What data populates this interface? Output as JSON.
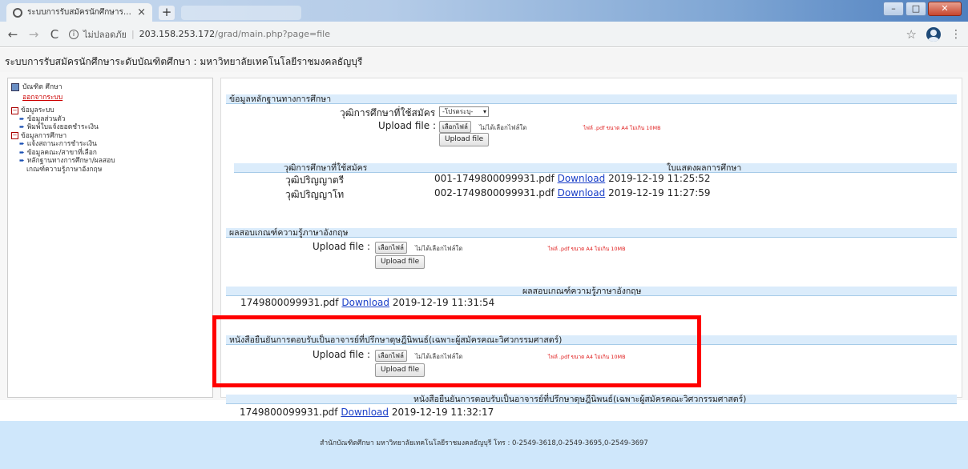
{
  "browser": {
    "tab_title": "ระบบการรับสมัครนักศึกษาระดับปริญญ",
    "tab_close": "×",
    "newtab": "+",
    "url_security": "ไม่ปลอดภัย",
    "url_host": "203.158.253.172",
    "url_path": "/grad/main.php?page=file",
    "window_controls": {
      "minimize": "–",
      "maximize": "□",
      "close": "✕"
    }
  },
  "page_header": "ระบบการรับสมัครนักศึกษาระดับบัณฑิตศึกษา : มหาวิทยาลัยเทคโนโลยีราชมงคลธัญบุรี",
  "sidebar": {
    "user": "บัณฑิต ศึกษา",
    "logout": "ออกจากระบบ",
    "groups": [
      {
        "title": "ข้อมูลระบบ",
        "items": [
          "ข้อมูลส่วนตัว",
          "พิมพ์ใบแจ้งยอดชำระเงิน"
        ]
      },
      {
        "title": "ข้อมูลการศึกษา",
        "items": [
          "แจ้งสถานะการชำระเงิน",
          "ข้อมูลคณะ/สาขาที่เลือก",
          "หลักฐานทางการศึกษา/ผลสอบ",
          "เกณฑ์ความรู้ภาษาอังกฤษ"
        ]
      }
    ]
  },
  "section1": {
    "title": "ข้อมูลหลักฐานทางการศึกษา",
    "degree_label": "วุฒิการศึกษาที่ใช้สมัคร :",
    "degree_select": "-โปรดระบุ-",
    "upload_label": "Upload file :",
    "choose_button": "เลือกไฟล์",
    "no_file": "ไม่ได้เลือกไฟล์ใด",
    "note": "ไฟล์ .pdf ขนาด A4 ไม่เกิน 10MB",
    "upload_button": "Upload file",
    "table_headers": [
      "วุฒิการศึกษาที่ใช้สมัคร",
      "ใบแสดงผลการศึกษา"
    ],
    "rows": [
      {
        "degree": "วุฒิปริญญาตรี",
        "file": "001-1749800099931.pdf",
        "link": "Download",
        "date": "2019-12-19 11:25:52"
      },
      {
        "degree": "วุฒิปริญญาโท",
        "file": "002-1749800099931.pdf",
        "link": "Download",
        "date": "2019-12-19 11:27:59"
      }
    ]
  },
  "section2": {
    "title": "ผลสอบเกณฑ์ความรู้ภาษาอังกฤษ",
    "upload_label": "Upload file :",
    "choose_button": "เลือกไฟล์",
    "no_file": "ไม่ได้เลือกไฟล์ใด",
    "note": "ไฟล์ .pdf ขนาด A4 ไม่เกิน 10MB",
    "upload_button": "Upload file",
    "table_header": "ผลสอบเกณฑ์ความรู้ภาษาอังกฤษ",
    "row": {
      "file": "1749800099931.pdf",
      "link": "Download",
      "date": "2019-12-19 11:31:54"
    }
  },
  "section3": {
    "title": "หนังสือยืนยันการตอบรับเป็นอาจารย์ที่ปรึกษาดุษฎีนิพนธ์(เฉพาะผู้สมัครคณะวิศวกรรมศาสตร์)",
    "upload_label": "Upload file :",
    "choose_button": "เลือกไฟล์",
    "no_file": "ไม่ได้เลือกไฟล์ใด",
    "note": "ไฟล์ .pdf ขนาด A4 ไม่เกิน 10MB",
    "upload_button": "Upload file",
    "table_header": "หนังสือยืนยันการตอบรับเป็นอาจารย์ที่ปรึกษาดุษฎีนิพนธ์(เฉพาะผู้สมัครคณะวิศวกรรมศาสตร์)",
    "row": {
      "file": "1749800099931.pdf",
      "link": "Download",
      "date": "2019-12-19 11:32:17"
    }
  },
  "footer": "สำนักบัณฑิตศึกษา มหาวิทยาลัยเทคโนโลยีราชมงคลธัญบุรี โทร : 0-2549-3618,0-2549-3695,0-2549-3697",
  "colors": {
    "highlight": "#ff0000",
    "section_bar": "#dbecfb",
    "footer_bg": "#cfe7fb",
    "link": "#1a3fc8"
  }
}
